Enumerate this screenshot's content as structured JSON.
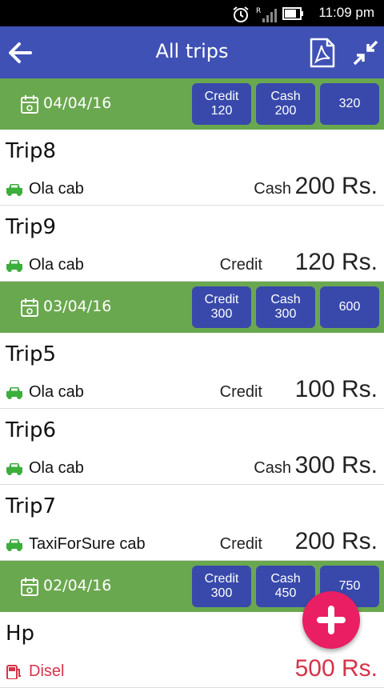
{
  "status_bar": {
    "time": "11:09 pm"
  },
  "app_bar": {
    "title": "All trips"
  },
  "groups": [
    {
      "date": "04/04/16",
      "credit_label": "Credit",
      "credit": "120",
      "cash_label": "Cash",
      "cash": "200",
      "total": "320",
      "trips": [
        {
          "name": "Trip8",
          "vehicle": "Ola cab",
          "mode": "Cash",
          "amount": "200 Rs."
        },
        {
          "name": "Trip9",
          "vehicle": "Ola cab",
          "mode": "Credit",
          "amount": "120 Rs."
        }
      ]
    },
    {
      "date": "03/04/16",
      "credit_label": "Credit",
      "credit": "300",
      "cash_label": "Cash",
      "cash": "300",
      "total": "600",
      "trips": [
        {
          "name": "Trip5",
          "vehicle": "Ola cab",
          "mode": "Credit",
          "amount": "100 Rs."
        },
        {
          "name": "Trip6",
          "vehicle": "Ola cab",
          "mode": "Cash",
          "amount": "300 Rs."
        },
        {
          "name": "Trip7",
          "vehicle": "TaxiForSure cab",
          "mode": "Credit",
          "amount": "200 Rs."
        }
      ]
    },
    {
      "date": "02/04/16",
      "credit_label": "Credit",
      "credit": "300",
      "cash_label": "Cash",
      "cash": "450",
      "total": "750",
      "trips": [
        {
          "name": "Hp",
          "vehicle": "Disel",
          "mode": "",
          "amount": "500 Rs."
        }
      ]
    }
  ],
  "colors": {
    "app_bar": "#3f51b5",
    "date_header": "#6aa84f",
    "chip": "#3949ab",
    "fab": "#e91e63",
    "car_icon": "#3cae3c",
    "fuel": "#d63348"
  },
  "icons": {
    "back": "arrow-left-icon",
    "pdf": "pdf-icon",
    "collapse": "collapse-icon",
    "calendar": "calendar-icon",
    "car": "car-icon",
    "add": "plus-icon"
  }
}
